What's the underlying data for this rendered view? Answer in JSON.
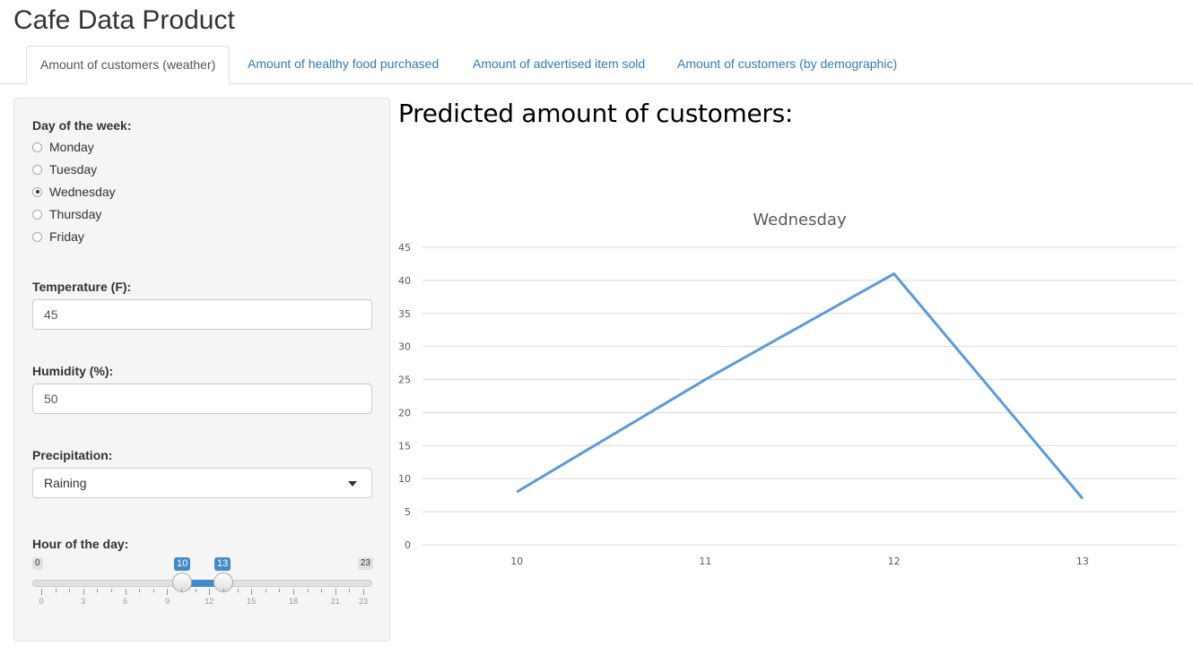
{
  "app": {
    "title": "Cafe Data Product"
  },
  "tabs": [
    {
      "label": "Amount of customers (weather)",
      "active": true
    },
    {
      "label": "Amount of healthy food purchased",
      "active": false
    },
    {
      "label": "Amount of advertised item sold",
      "active": false
    },
    {
      "label": "Amount of customers (by demographic)",
      "active": false
    }
  ],
  "sidebar": {
    "day": {
      "label": "Day of the week:",
      "options": [
        "Monday",
        "Tuesday",
        "Wednesday",
        "Thursday",
        "Friday"
      ],
      "selected": "Wednesday"
    },
    "temperature": {
      "label": "Temperature (F):",
      "value": "45"
    },
    "humidity": {
      "label": "Humidity (%):",
      "value": "50"
    },
    "precipitation": {
      "label": "Precipitation:",
      "selected": "Raining"
    },
    "hour": {
      "label": "Hour of the day:",
      "min": "0",
      "max": "23",
      "from": "10",
      "to": "13",
      "tick_labels": [
        "0",
        "3",
        "6",
        "9",
        "12",
        "15",
        "18",
        "21",
        "23"
      ]
    }
  },
  "main": {
    "heading": "Predicted amount of customers:"
  },
  "colors": {
    "accent": "#428bca",
    "line": "#5b9bd5",
    "link": "#337ab7"
  },
  "chart_data": {
    "type": "line",
    "title": "Wednesday",
    "categories": [
      "10",
      "11",
      "12",
      "13"
    ],
    "series": [
      {
        "values": [
          8,
          25,
          41,
          7
        ]
      }
    ],
    "ylim": [
      0,
      45
    ],
    "yticks": [
      0,
      5,
      10,
      15,
      20,
      25,
      30,
      35,
      40,
      45
    ],
    "grid": true,
    "xlabel": "",
    "ylabel": ""
  }
}
